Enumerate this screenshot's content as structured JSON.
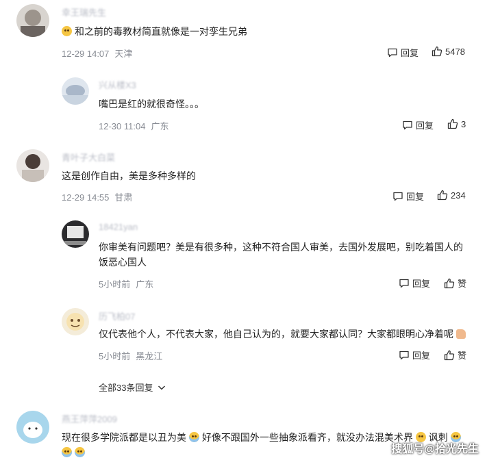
{
  "comments": [
    {
      "username": "幸王瑞先生",
      "text": "和之前的毒教材简直就像是一对孪生兄弟",
      "time": "12-29 14:07",
      "location": "天津",
      "reply_label": "回复",
      "likes": "5478",
      "replies": [
        {
          "username": "兴从楼X3",
          "text": "嘴巴是红的就很奇怪。。。",
          "time": "12-30 11:04",
          "location": "广东",
          "reply_label": "回复",
          "likes": "3"
        }
      ]
    },
    {
      "username": "青叶子大白菜",
      "text": "这是创作自由，美是多种多样的",
      "time": "12-29 14:55",
      "location": "甘肃",
      "reply_label": "回复",
      "likes": "234",
      "replies": [
        {
          "username": "18421yan",
          "text": "你审美有问题吧？美是有很多种，这种不符合国人审美，去国外发展吧，别吃着国人的饭恶心国人",
          "time": "5小时前",
          "location": "广东",
          "reply_label": "回复",
          "likes": "赞"
        },
        {
          "username": "历飞柏07",
          "text": "仅代表他个人，不代表大家，他自己认为的，就要大家都认同？大家都眼明心净着呢",
          "time": "5小时前",
          "location": "黑龙江",
          "reply_label": "回复",
          "likes": "赞"
        }
      ],
      "expand_label": "全部33条回复"
    },
    {
      "username": "燕王萍萍2009",
      "text": "现在很多学院派都是以丑为美",
      "text2": "好像不跟国外一些抽象派看齐，就没办法混美术界",
      "text3": "讽刺"
    }
  ],
  "watermark": "搜狐号@拾光先生",
  "colors": {
    "username": "#b9bcc6",
    "meta": "#888c94",
    "text": "#222222"
  },
  "icons": [
    "reply-icon",
    "thumb-up-icon",
    "chevron-down-icon",
    "laugh-emoji-icon",
    "sweat-emoji-icon",
    "thumb-emoji-icon"
  ]
}
